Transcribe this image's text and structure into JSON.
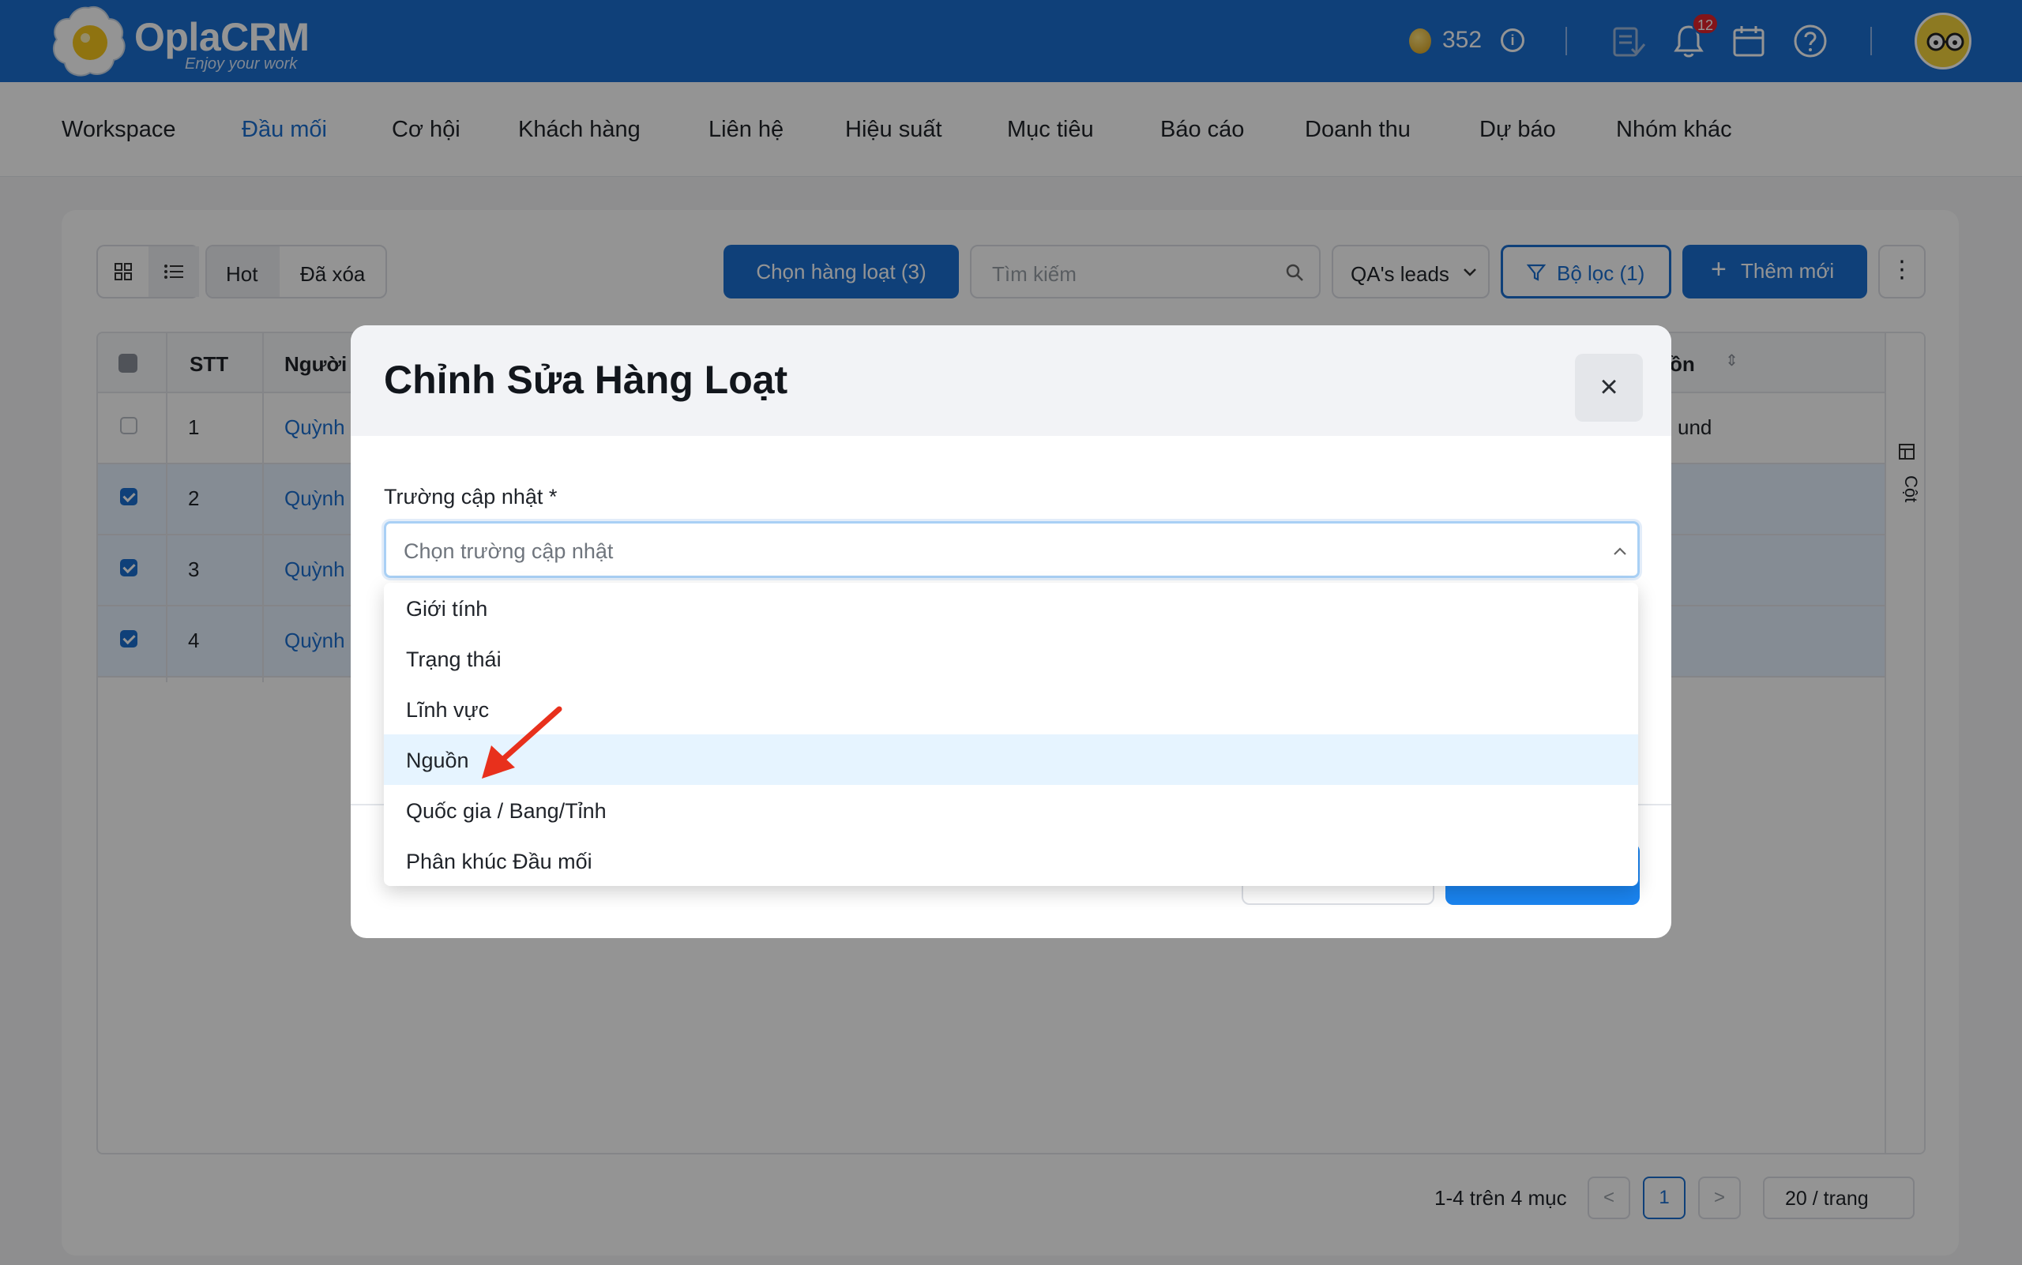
{
  "header": {
    "brand": "OplaCRM",
    "tagline": "Enjoy your work",
    "coins": "352",
    "notification_count": "12"
  },
  "nav": {
    "items": [
      "Workspace",
      "Đầu mối",
      "Cơ hội",
      "Khách hàng",
      "Liên hệ",
      "Hiệu suất",
      "Mục tiêu",
      "Báo cáo",
      "Doanh thu",
      "Dự báo",
      "Nhóm khác"
    ],
    "active": "Đầu mối"
  },
  "toolbar": {
    "hot_label": "Hot",
    "deleted_label": "Đã xóa",
    "bulk_select_label": "Chọn hàng loạt (3)",
    "search_placeholder": "Tìm kiếm",
    "view_select": "QA's leads",
    "filter_label": "Bộ lọc (1)",
    "add_new_label": "Thêm mới"
  },
  "table": {
    "columns": [
      "STT",
      "Người",
      "ồn"
    ],
    "rows": [
      {
        "stt": "1",
        "name": "Quỳnh",
        "source": "und",
        "selected": false
      },
      {
        "stt": "2",
        "name": "Quỳnh",
        "source": "",
        "selected": true
      },
      {
        "stt": "3",
        "name": "Quỳnh",
        "source": "",
        "selected": true
      },
      {
        "stt": "4",
        "name": "Quỳnh",
        "source": "",
        "selected": true
      }
    ],
    "side_label": "Cột"
  },
  "pagination": {
    "summary": "1-4 trên 4 mục",
    "current_page": "1",
    "page_size": "20 / trang"
  },
  "modal": {
    "title": "Chỉnh Sửa Hàng Loạt",
    "field_label": "Trường cập nhật *",
    "field_placeholder": "Chọn trường cập nhật",
    "options": [
      "Giới tính",
      "Trạng thái",
      "Lĩnh vực",
      "Nguồn",
      "Quốc gia / Bang/Tỉnh",
      "Phân khúc Đầu mối"
    ],
    "highlighted_option": "Nguồn"
  },
  "colors": {
    "primary": "#1a6fd1",
    "highlight": "#e6f4ff",
    "arrow": "#e8301c"
  }
}
